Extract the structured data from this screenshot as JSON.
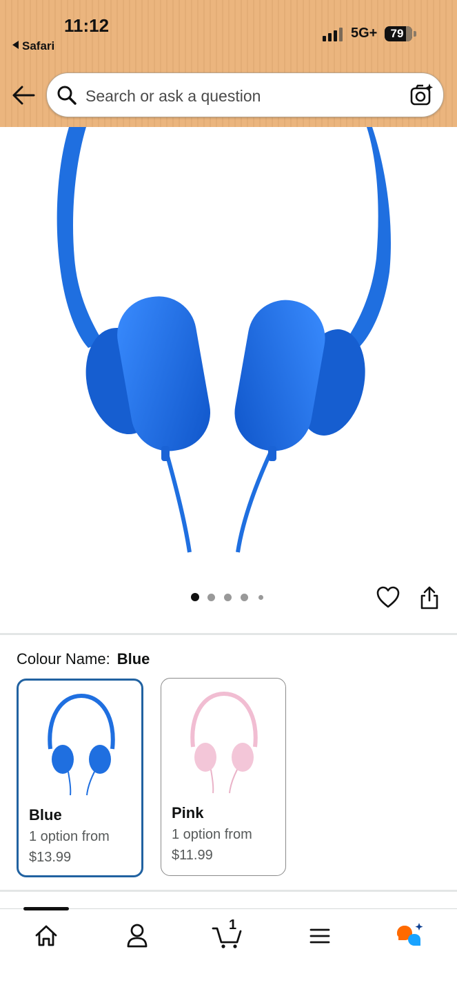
{
  "status_bar": {
    "time": "11:12",
    "back_app": "Safari",
    "network": "5G+",
    "battery": "79"
  },
  "search": {
    "placeholder": "Search or ask a question"
  },
  "gallery": {
    "image_count": 5,
    "active_index": 0
  },
  "variant": {
    "label": "Colour Name:",
    "selected_value": "Blue",
    "options": [
      {
        "name": "Blue",
        "line1": "1 option from",
        "price": "$13.99",
        "color": "#1f6fe0"
      },
      {
        "name": "Pink",
        "line1": "1 option from",
        "price": "$11.99",
        "color": "#f3c6d8"
      }
    ]
  },
  "bottom_nav": {
    "items": [
      "home-icon",
      "account-icon",
      "cart-icon",
      "menu-icon",
      "rufus-icon"
    ],
    "cart_count": "1"
  },
  "colors": {
    "header_bg": "#ebb57e",
    "selected_border": "#2162a1",
    "headphone_blue": "#1f6fe0",
    "rufus_orange": "#ff6a00",
    "rufus_blue": "#1aa3ff"
  }
}
